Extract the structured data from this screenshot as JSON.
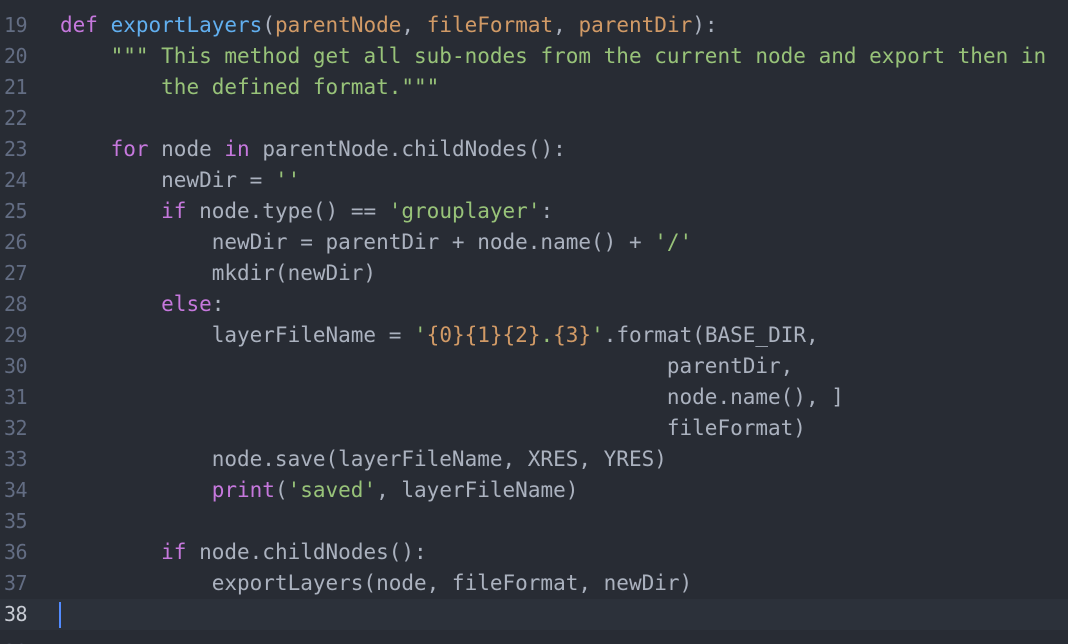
{
  "editor": {
    "language": "python",
    "cursor_line": "38",
    "partial_lines": {
      "top": "18",
      "bottom": "39"
    },
    "lines": [
      {
        "num": "19",
        "tokens": [
          {
            "t": "def",
            "c": "kw"
          },
          {
            "t": " ",
            "c": "plain"
          },
          {
            "t": "exportLayers",
            "c": "fn"
          },
          {
            "t": "(",
            "c": "plain"
          },
          {
            "t": "parentNode",
            "c": "param"
          },
          {
            "t": ", ",
            "c": "plain"
          },
          {
            "t": "fileFormat",
            "c": "param"
          },
          {
            "t": ", ",
            "c": "plain"
          },
          {
            "t": "parentDir",
            "c": "param"
          },
          {
            "t": "):",
            "c": "plain"
          }
        ]
      },
      {
        "num": "20",
        "tokens": [
          {
            "t": "    ",
            "c": "plain"
          },
          {
            "t": "\"\"\" This method get all sub-nodes from the current node and export then in",
            "c": "str"
          }
        ]
      },
      {
        "num": "21",
        "tokens": [
          {
            "t": "        ",
            "c": "plain"
          },
          {
            "t": "the defined format.\"\"\"",
            "c": "str"
          }
        ]
      },
      {
        "num": "22",
        "tokens": []
      },
      {
        "num": "23",
        "tokens": [
          {
            "t": "    ",
            "c": "plain"
          },
          {
            "t": "for",
            "c": "kw"
          },
          {
            "t": " node ",
            "c": "plain"
          },
          {
            "t": "in",
            "c": "kw"
          },
          {
            "t": " parentNode.childNodes():",
            "c": "plain"
          }
        ]
      },
      {
        "num": "24",
        "tokens": [
          {
            "t": "        newDir = ",
            "c": "plain"
          },
          {
            "t": "''",
            "c": "str"
          }
        ]
      },
      {
        "num": "25",
        "tokens": [
          {
            "t": "        ",
            "c": "plain"
          },
          {
            "t": "if",
            "c": "kw"
          },
          {
            "t": " node.type() == ",
            "c": "plain"
          },
          {
            "t": "'grouplayer'",
            "c": "str"
          },
          {
            "t": ":",
            "c": "plain"
          }
        ]
      },
      {
        "num": "26",
        "tokens": [
          {
            "t": "            newDir = parentDir + node.name() + ",
            "c": "plain"
          },
          {
            "t": "'/'",
            "c": "str"
          }
        ]
      },
      {
        "num": "27",
        "tokens": [
          {
            "t": "            mkdir(newDir)",
            "c": "plain"
          }
        ]
      },
      {
        "num": "28",
        "tokens": [
          {
            "t": "        ",
            "c": "plain"
          },
          {
            "t": "else",
            "c": "kw"
          },
          {
            "t": ":",
            "c": "plain"
          }
        ]
      },
      {
        "num": "29",
        "tokens": [
          {
            "t": "            layerFileName = ",
            "c": "plain"
          },
          {
            "t": "'",
            "c": "str"
          },
          {
            "t": "{0}{1}{2}",
            "c": "fmt"
          },
          {
            "t": ".",
            "c": "str"
          },
          {
            "t": "{3}",
            "c": "fmt"
          },
          {
            "t": "'",
            "c": "str"
          },
          {
            "t": ".format(BASE_DIR,",
            "c": "plain"
          }
        ]
      },
      {
        "num": "30",
        "tokens": [
          {
            "t": "                                                parentDir,",
            "c": "plain"
          }
        ]
      },
      {
        "num": "31",
        "tokens": [
          {
            "t": "                                                node.name(), ]",
            "c": "plain"
          }
        ]
      },
      {
        "num": "32",
        "tokens": [
          {
            "t": "                                                fileFormat)",
            "c": "plain"
          }
        ]
      },
      {
        "num": "33",
        "tokens": [
          {
            "t": "            node.save(layerFileName, XRES, YRES)",
            "c": "plain"
          }
        ]
      },
      {
        "num": "34",
        "tokens": [
          {
            "t": "            ",
            "c": "plain"
          },
          {
            "t": "print",
            "c": "kw"
          },
          {
            "t": "(",
            "c": "plain"
          },
          {
            "t": "'saved'",
            "c": "str"
          },
          {
            "t": ", layerFileName)",
            "c": "plain"
          }
        ]
      },
      {
        "num": "35",
        "tokens": []
      },
      {
        "num": "36",
        "tokens": [
          {
            "t": "        ",
            "c": "plain"
          },
          {
            "t": "if",
            "c": "kw"
          },
          {
            "t": " node.childNodes():",
            "c": "plain"
          }
        ]
      },
      {
        "num": "37",
        "tokens": [
          {
            "t": "            exportLayers(node, fileFormat, newDir)",
            "c": "plain"
          }
        ]
      },
      {
        "num": "38",
        "tokens": []
      }
    ]
  },
  "colors": {
    "background": "#282c34",
    "active_line": "#2c313a",
    "keyword": "#c678dd",
    "function": "#61afef",
    "parameter": "#d19a66",
    "string": "#98c379",
    "plain": "#abb2bf",
    "gutter": "#636d83",
    "cursor": "#528bff"
  }
}
